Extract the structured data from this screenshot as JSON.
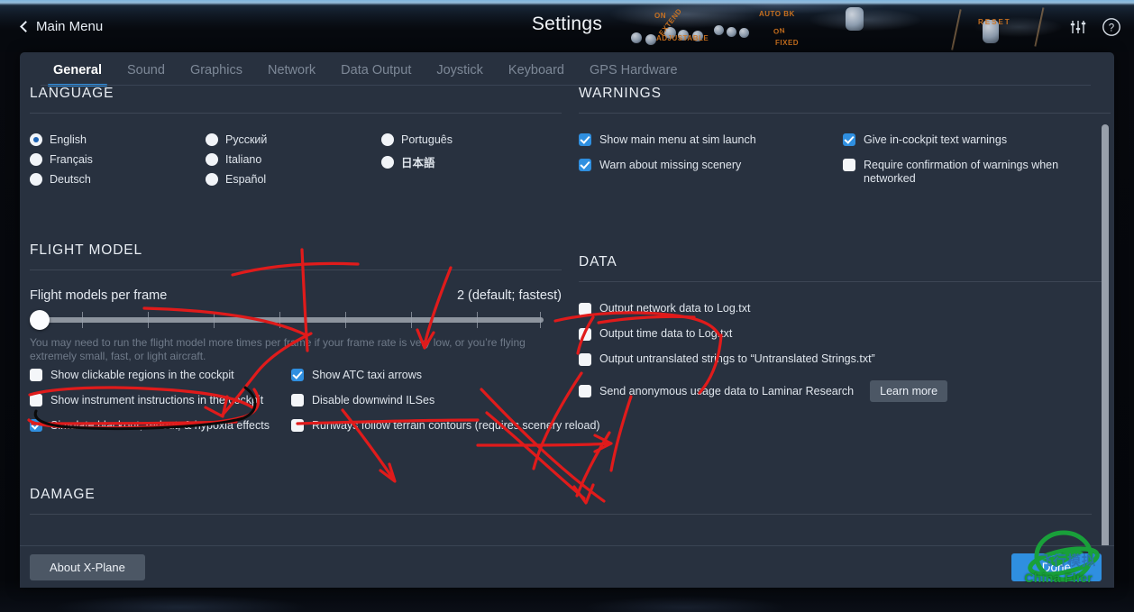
{
  "header": {
    "back_label": "Main Menu",
    "title": "Settings",
    "back_icon": "chevron-left-icon",
    "sliders_icon": "sliders-icon",
    "help_icon": "question-circle-icon"
  },
  "tabs": [
    {
      "label": "General",
      "active": true
    },
    {
      "label": "Sound",
      "active": false
    },
    {
      "label": "Graphics",
      "active": false
    },
    {
      "label": "Network",
      "active": false
    },
    {
      "label": "Data Output",
      "active": false
    },
    {
      "label": "Joystick",
      "active": false
    },
    {
      "label": "Keyboard",
      "active": false
    },
    {
      "label": "GPS Hardware",
      "active": false
    }
  ],
  "language": {
    "title": "LANGUAGE",
    "columns": [
      [
        {
          "label": "English",
          "selected": true
        },
        {
          "label": "Français",
          "selected": false
        },
        {
          "label": "Deutsch",
          "selected": false
        }
      ],
      [
        {
          "label": "Русский",
          "selected": false
        },
        {
          "label": "Italiano",
          "selected": false
        },
        {
          "label": "Español",
          "selected": false
        }
      ],
      [
        {
          "label": "Português",
          "selected": false
        },
        {
          "label": "日本語",
          "selected": false
        }
      ]
    ]
  },
  "warnings": {
    "title": "WARNINGS",
    "left": [
      {
        "label": "Show main menu at sim launch",
        "checked": true
      },
      {
        "label": "Warn about missing scenery",
        "checked": true
      }
    ],
    "right": [
      {
        "label": "Give in-cockpit text warnings",
        "checked": true
      },
      {
        "label": "Require confirmation of warnings when networked",
        "checked": false
      }
    ]
  },
  "flight_model": {
    "title": "FLIGHT MODEL",
    "slider_label": "Flight models per frame",
    "slider_value_text": "2 (default; fastest)",
    "slider_value": 2,
    "slider_min": 2,
    "slider_max": 10,
    "slider_ticks": 8,
    "help_text": "You may need to run the flight model more times per frame if your frame rate is very low, or you’re flying extremely small, fast, or light aircraft.",
    "left": [
      {
        "label": "Show clickable regions in the cockpit",
        "checked": false
      },
      {
        "label": "Show instrument instructions in the cockpit",
        "checked": false
      },
      {
        "label": "Simulate blackout, redout, & hypoxia effects",
        "checked": true
      }
    ],
    "right": [
      {
        "label": "Show ATC taxi arrows",
        "checked": true
      },
      {
        "label": "Disable downwind ILSes",
        "checked": false
      },
      {
        "label": "Runways follow terrain contours (requires scenery reload)",
        "checked": false
      }
    ]
  },
  "data": {
    "title": "DATA",
    "items": [
      {
        "label": "Output network data to Log.txt",
        "checked": false
      },
      {
        "label": "Output time data to Log.txt",
        "checked": false
      },
      {
        "label": "Output untranslated strings to “Untranslated Strings.txt”",
        "checked": false
      },
      {
        "label": "Send anonymous usage data to Laminar Research",
        "checked": false,
        "button": "Learn more"
      }
    ]
  },
  "damage": {
    "title": "DAMAGE"
  },
  "footer": {
    "about_label": "About X-Plane",
    "done_label": "Done"
  },
  "watermark": {
    "brand": "China Flier",
    "cn_text": "飞行模拟",
    "color": "#19a03a"
  },
  "background_labels": [
    {
      "text": "EXTEND"
    },
    {
      "text": "ON"
    },
    {
      "text": "ADJUSTABLE"
    },
    {
      "text": "ON"
    },
    {
      "text": "FIXED"
    },
    {
      "text": "ON"
    },
    {
      "text": "AUTO BK"
    },
    {
      "text": "RESET"
    }
  ],
  "colors": {
    "panel": "#28313f",
    "accent": "#2f8fe0",
    "text": "#dfe5ec",
    "muted": "#7d8897",
    "annotation": "#e01b1b",
    "annotation_secondary": "#000000"
  }
}
